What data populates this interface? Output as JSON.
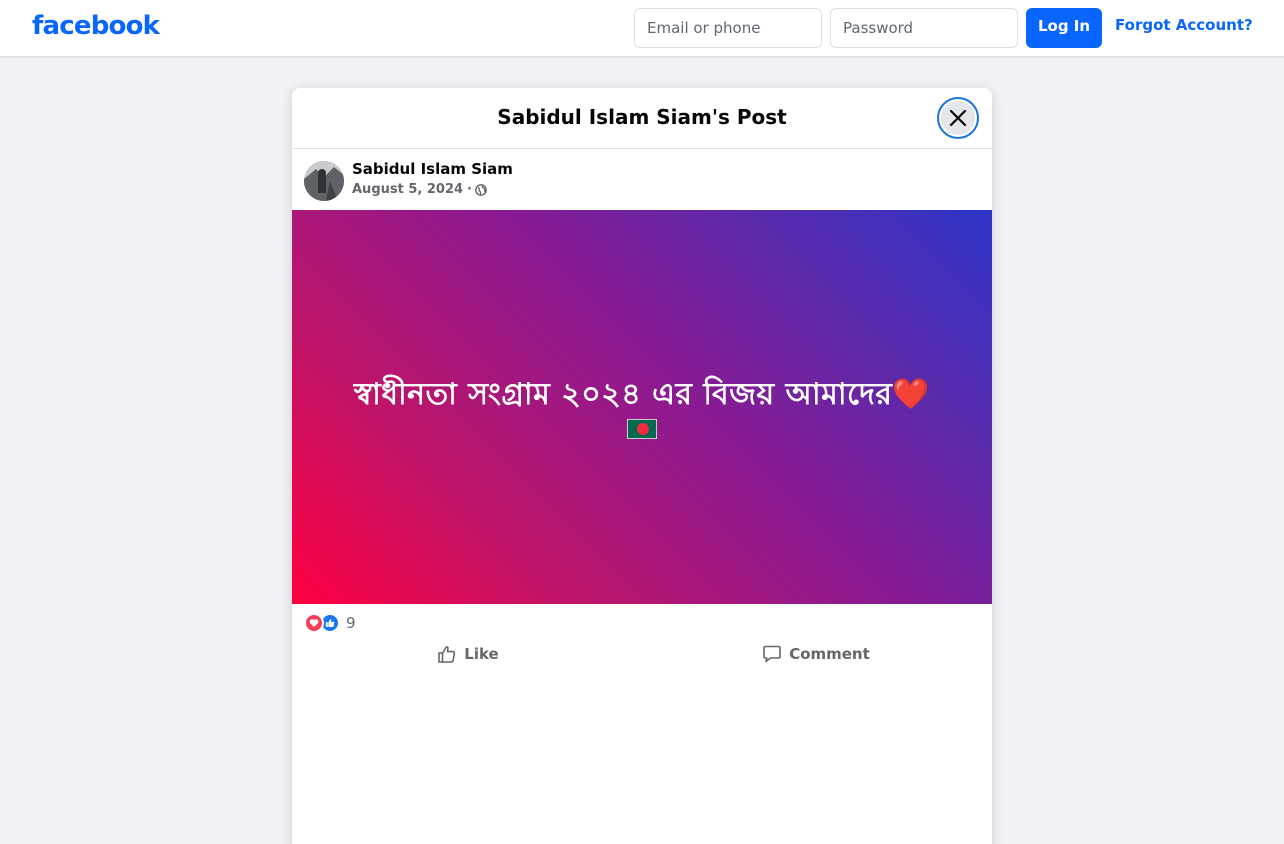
{
  "header": {
    "logo_text": "facebook",
    "email_placeholder": "Email or phone",
    "password_placeholder": "Password",
    "login_label": "Log In",
    "forgot_label": "Forgot Account?"
  },
  "modal": {
    "title": "Sabidul Islam Siam's Post",
    "close_icon": "close-icon"
  },
  "post": {
    "author": "Sabidul Islam Siam",
    "date": "August 5, 2024",
    "separator": "·",
    "privacy_icon": "globe-icon",
    "text": "স্বাধীনতা সংগ্রাম ২০২৪ এর বিজয় আমাদের❤️",
    "flag_icon": "bangladesh-flag-icon",
    "reactions": {
      "icons": [
        "love-icon",
        "like-icon"
      ],
      "count": "9"
    },
    "actions": {
      "like_label": "Like",
      "comment_label": "Comment"
    }
  },
  "colors": {
    "brand_blue": "#0866ff",
    "page_background": "#f0f2f5",
    "gradient": [
      "#ff0040",
      "#8a1a92",
      "#2d35c9"
    ],
    "love_red": "#f33e58",
    "like_blue": "#1877f2"
  }
}
